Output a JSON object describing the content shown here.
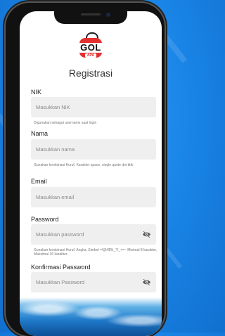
{
  "app": {
    "logo_text": "GOL",
    "logo_sub": "APA"
  },
  "page_title": "Registrasi",
  "form": {
    "nik": {
      "label": "NIK",
      "placeholder": "Masukkan NIK",
      "hint": "Digunakan sebagai username saat login"
    },
    "nama": {
      "label": "Nama",
      "placeholder": "Masukkan nama",
      "hint": "Gunakan kombinasi Huruf, Karakter space, single quote dot titik"
    },
    "email": {
      "label": "Email",
      "placeholder": "Masukkan email"
    },
    "password": {
      "label": "Password",
      "placeholder": "Masukkan password",
      "hint": "Gunakan kombinasi Huruf, Angka, Simbol =!@#$%_?/_+=~ Minimal 8 karakter, Maksimal 16 karakter",
      "toggle_icon": "eye-off-icon"
    },
    "konfirmasi": {
      "label": "Konfirmasi Password",
      "placeholder": "Masukkan Password",
      "toggle_icon": "eye-off-icon"
    }
  }
}
